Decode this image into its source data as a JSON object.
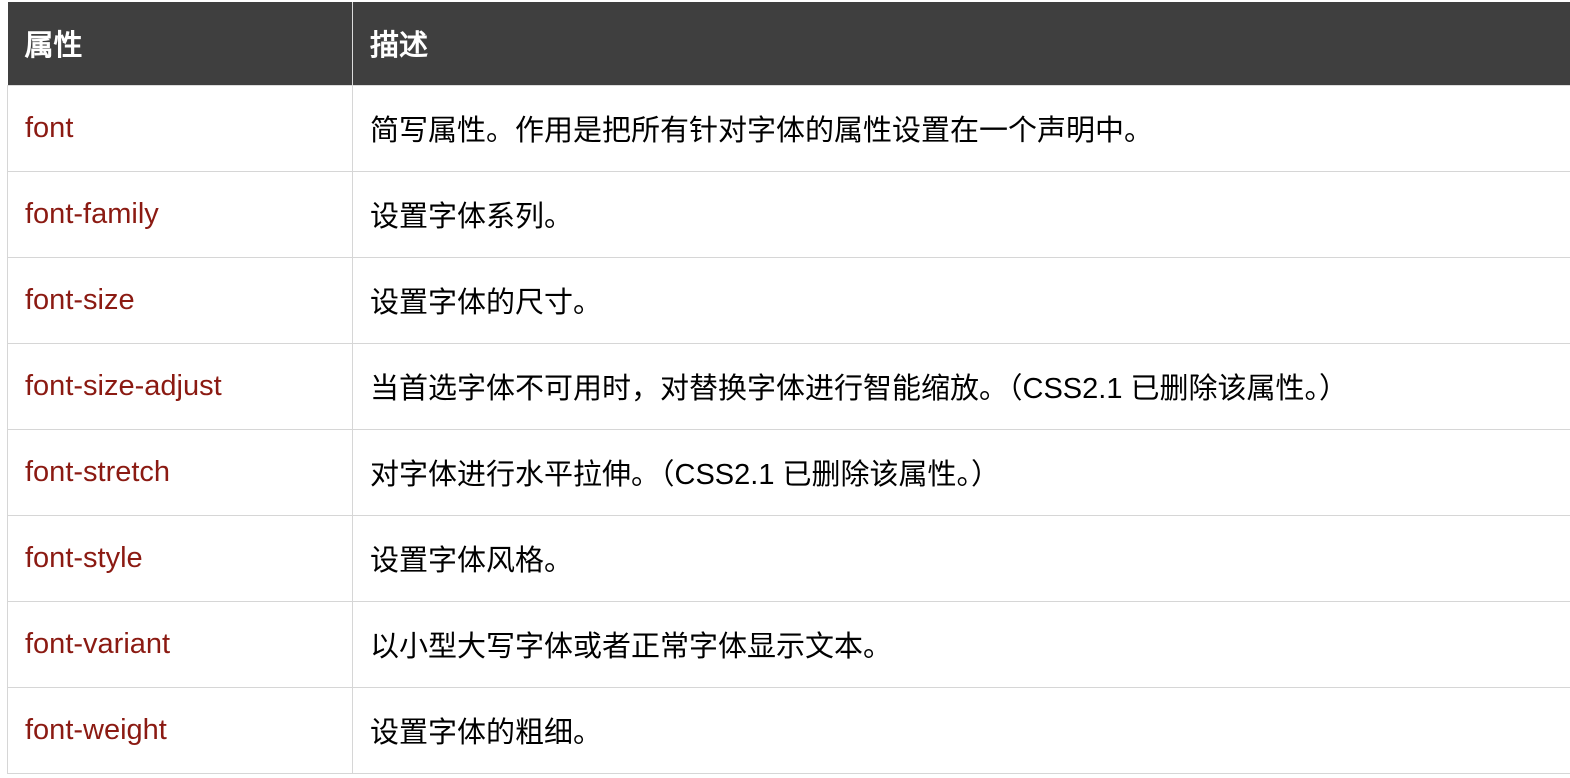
{
  "table": {
    "headers": [
      "属性",
      "描述"
    ],
    "rows": [
      {
        "property": "font",
        "description": "简写属性。作用是把所有针对字体的属性设置在一个声明中。"
      },
      {
        "property": "font-family",
        "description": "设置字体系列。"
      },
      {
        "property": "font-size",
        "description": "设置字体的尺寸。"
      },
      {
        "property": "font-size-adjust",
        "description": "当首选字体不可用时，对替换字体进行智能缩放。（CSS2.1 已删除该属性。）"
      },
      {
        "property": "font-stretch",
        "description": "对字体进行水平拉伸。（CSS2.1 已删除该属性。）"
      },
      {
        "property": "font-style",
        "description": "设置字体风格。"
      },
      {
        "property": "font-variant",
        "description": "以小型大写字体或者正常字体显示文本。"
      },
      {
        "property": "font-weight",
        "description": "设置字体的粗细。"
      }
    ]
  },
  "colors": {
    "header_bg": "#3f3f3f",
    "header_text": "#ffffff",
    "link": "#8b1a12",
    "border": "#d6d6d6"
  }
}
